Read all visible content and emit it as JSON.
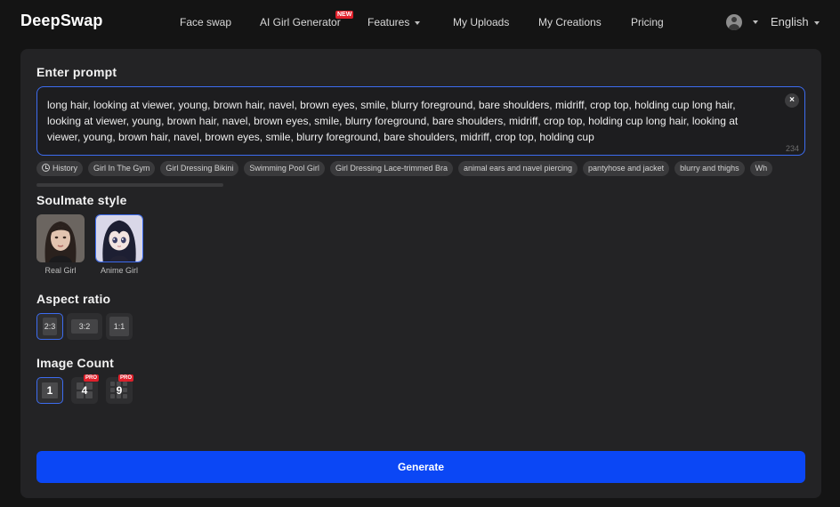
{
  "brand": {
    "logo": "DeepSwap"
  },
  "nav": {
    "items": [
      {
        "label": "Face swap"
      },
      {
        "label": "AI Girl Generator",
        "badge": "NEW"
      },
      {
        "label": "Features"
      },
      {
        "label": "My Uploads"
      },
      {
        "label": "My Creations"
      },
      {
        "label": "Pricing"
      }
    ],
    "language": "English"
  },
  "prompt": {
    "title": "Enter prompt",
    "value": "long hair, looking at viewer, young, brown hair, navel, brown eyes, smile, blurry foreground, bare shoulders, midriff, crop top, holding cup long hair, looking at viewer, young, brown hair, navel, brown eyes, smile, blurry foreground, bare shoulders, midriff, crop top, holding cup long hair, looking at viewer, young, brown hair, navel, brown eyes, smile, blurry foreground, bare shoulders, midriff, crop top, holding cup",
    "char_count": "234",
    "clear_icon": "close-icon"
  },
  "tags": {
    "history_label": "History",
    "items": [
      "Girl In The Gym",
      "Girl Dressing Bikini",
      "Swimming Pool Girl",
      "Girl Dressing Lace-trimmed Bra",
      "animal ears and navel piercing",
      "pantyhose and jacket",
      "blurry and thighs",
      "Wh"
    ]
  },
  "soulmate_style": {
    "title": "Soulmate style",
    "options": [
      {
        "label": "Real Girl",
        "selected": false
      },
      {
        "label": "Anime Girl",
        "selected": true
      }
    ]
  },
  "aspect_ratio": {
    "title": "Aspect ratio",
    "options": [
      {
        "label": "2:3",
        "selected": true
      },
      {
        "label": "3:2",
        "selected": false
      },
      {
        "label": "1:1",
        "selected": false
      }
    ]
  },
  "image_count": {
    "title": "Image Count",
    "options": [
      {
        "label": "1",
        "selected": true
      },
      {
        "label": "4",
        "badge": "PRO",
        "selected": false
      },
      {
        "label": "9",
        "badge": "PRO",
        "selected": false
      }
    ]
  },
  "generate": {
    "label": "Generate"
  },
  "colors": {
    "accent": "#3d6cf0",
    "generate_button": "#0b47f5",
    "badge": "#e0202b",
    "panel": "#232325",
    "background": "#141414"
  }
}
